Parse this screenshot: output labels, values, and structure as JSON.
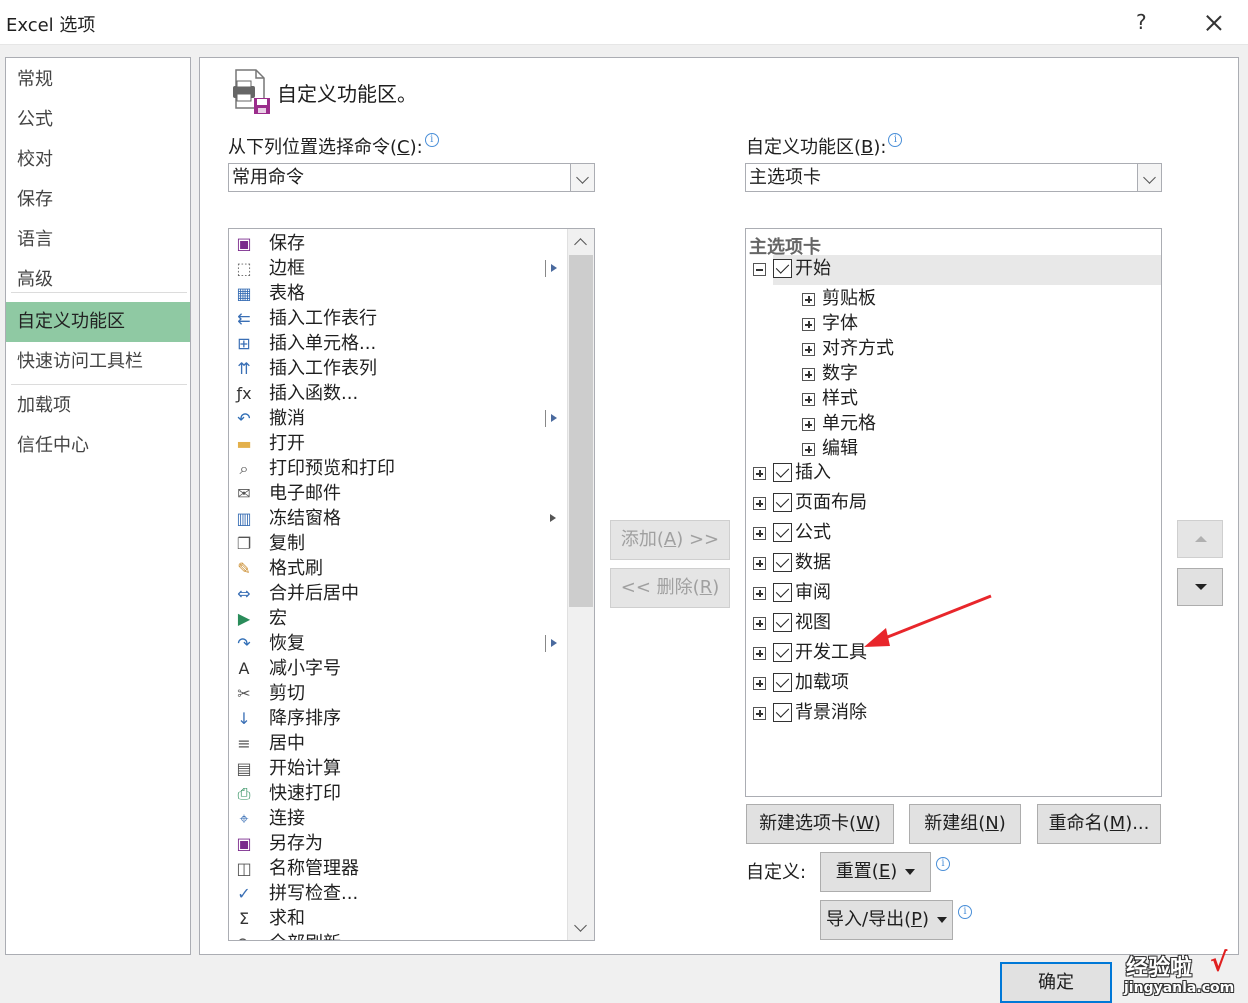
{
  "window": {
    "title": "Excel 选项",
    "help": "?"
  },
  "nav": {
    "items": [
      "常规",
      "公式",
      "校对",
      "保存",
      "语言",
      "高级",
      "自定义功能区",
      "快速访问工具栏",
      "加载项",
      "信任中心"
    ],
    "selected": "自定义功能区"
  },
  "page": {
    "title": "自定义功能区。"
  },
  "left": {
    "label_text": "从下列位置选择命令(",
    "label_key": "C",
    "label_end": "):",
    "combo_value": "常用命令",
    "commands": [
      {
        "label": "保存",
        "icon": "save-icon"
      },
      {
        "label": "边框",
        "icon": "border-icon",
        "submenu": "bar"
      },
      {
        "label": "表格",
        "icon": "table-icon"
      },
      {
        "label": "插入工作表行",
        "icon": "insert-row-icon"
      },
      {
        "label": "插入单元格...",
        "icon": "insert-cell-icon"
      },
      {
        "label": "插入工作表列",
        "icon": "insert-column-icon"
      },
      {
        "label": "插入函数...",
        "icon": "function-icon"
      },
      {
        "label": "撤消",
        "icon": "undo-icon",
        "submenu": "bar"
      },
      {
        "label": "打开",
        "icon": "open-folder-icon"
      },
      {
        "label": "打印预览和打印",
        "icon": "print-preview-icon"
      },
      {
        "label": "电子邮件",
        "icon": "email-icon"
      },
      {
        "label": "冻结窗格",
        "icon": "freeze-panes-icon",
        "submenu": "plain"
      },
      {
        "label": "复制",
        "icon": "copy-icon"
      },
      {
        "label": "格式刷",
        "icon": "format-painter-icon"
      },
      {
        "label": "合并后居中",
        "icon": "merge-center-icon"
      },
      {
        "label": "宏",
        "icon": "macro-icon"
      },
      {
        "label": "恢复",
        "icon": "redo-icon",
        "submenu": "bar"
      },
      {
        "label": "减小字号",
        "icon": "decrease-font-icon"
      },
      {
        "label": "剪切",
        "icon": "cut-icon"
      },
      {
        "label": "降序排序",
        "icon": "sort-descending-icon"
      },
      {
        "label": "居中",
        "icon": "align-center-icon"
      },
      {
        "label": "开始计算",
        "icon": "calculate-icon"
      },
      {
        "label": "快速打印",
        "icon": "quick-print-icon"
      },
      {
        "label": "连接",
        "icon": "connection-icon"
      },
      {
        "label": "另存为",
        "icon": "save-as-icon"
      },
      {
        "label": "名称管理器",
        "icon": "name-manager-icon"
      },
      {
        "label": "拼写检查...",
        "icon": "spell-check-icon"
      },
      {
        "label": "求和",
        "icon": "sum-icon"
      },
      {
        "label": "全部刷新",
        "icon": "refresh-all-icon"
      }
    ]
  },
  "middle": {
    "add_text": "添加(",
    "add_key": "A",
    "add_end": ") >>",
    "remove_text": "<< 删除(",
    "remove_key": "R",
    "remove_end": ")"
  },
  "right": {
    "label_text": "自定义功能区(",
    "label_key": "B",
    "label_end": "):",
    "combo_value": "主选项卡",
    "tree_header": "主选项卡",
    "root": "开始",
    "groups": [
      "剪贴板",
      "字体",
      "对齐方式",
      "数字",
      "样式",
      "单元格",
      "编辑"
    ],
    "tabs": [
      "插入",
      "页面布局",
      "公式",
      "数据",
      "审阅",
      "视图",
      "开发工具",
      "加载项",
      "背景消除"
    ],
    "new_tab_text": "新建选项卡(",
    "new_tab_key": "W",
    "new_tab_end": ")",
    "new_group_text": "新建组(",
    "new_group_key": "N",
    "new_group_end": ")",
    "rename_text": "重命名(",
    "rename_key": "M",
    "rename_end": ")...",
    "customize_label": "自定义:",
    "reset_text": "重置(",
    "reset_key": "E",
    "reset_end": ")",
    "import_text": "导入/导出(",
    "import_key": "P",
    "import_end": ")"
  },
  "footer": {
    "ok": "确定"
  },
  "watermark": {
    "line1": "经验啦",
    "check": "√",
    "line2": "jingyanla.com"
  },
  "colors": {
    "nav_selected": "#8fc9a3",
    "annotation_arrow": "#e8262b",
    "focus": "#0078d7"
  }
}
